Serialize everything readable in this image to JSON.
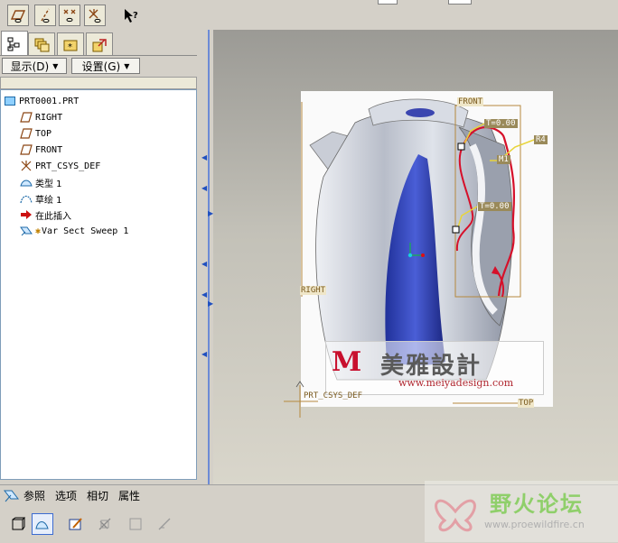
{
  "toolbar": {
    "icons": [
      "plane-eye-icon",
      "axis-eye-icon",
      "point-eye-icon",
      "csys-eye-icon",
      "context-help-icon"
    ]
  },
  "nav_tabs": [
    "model-tree-tab",
    "layer-tree-tab",
    "favorites-tab",
    "connections-tab"
  ],
  "tree_header": {
    "show_label": "显示(D)",
    "settings_label": "设置(G)"
  },
  "model_tree": {
    "root": "PRT0001.PRT",
    "items": [
      {
        "label": "RIGHT",
        "icon": "datum-plane-icon"
      },
      {
        "label": "TOP",
        "icon": "datum-plane-icon"
      },
      {
        "label": "FRONT",
        "icon": "datum-plane-icon"
      },
      {
        "label": "PRT_CSYS_DEF",
        "icon": "csys-icon"
      },
      {
        "label": "类型 1",
        "icon": "style-feature-icon"
      },
      {
        "label": "草绘 1",
        "icon": "sketch-icon"
      },
      {
        "label": "在此插入",
        "icon": "insert-here-arrow-icon"
      },
      {
        "label": "Var Sect Sweep 1",
        "icon": "var-sect-sweep-icon"
      }
    ]
  },
  "dashboard": {
    "tabs": [
      "参照",
      "选项",
      "相切",
      "属性"
    ],
    "tools": [
      "solid-icon",
      "surface-icon",
      "sketch-section-icon",
      "remove-material-icon",
      "thicken-icon",
      "trim-icon"
    ]
  },
  "viewport": {
    "labels": {
      "front": "FRONT",
      "right": "RIGHT",
      "top": "TOP",
      "csys": "PRT_CSYS_DEF",
      "t1": "T=0.00",
      "t2": "T=0.00",
      "m1": "M1",
      "r4": "R4"
    },
    "watermark": {
      "brand": "美雅設計",
      "url": "www.meiyadesign.com"
    }
  },
  "site_watermark": {
    "title": "野火论坛",
    "url": "www.proewildfire.cn"
  },
  "colors": {
    "trajectory": "#d6102a",
    "datum": "#b5883d",
    "accent": "#3548c8"
  }
}
